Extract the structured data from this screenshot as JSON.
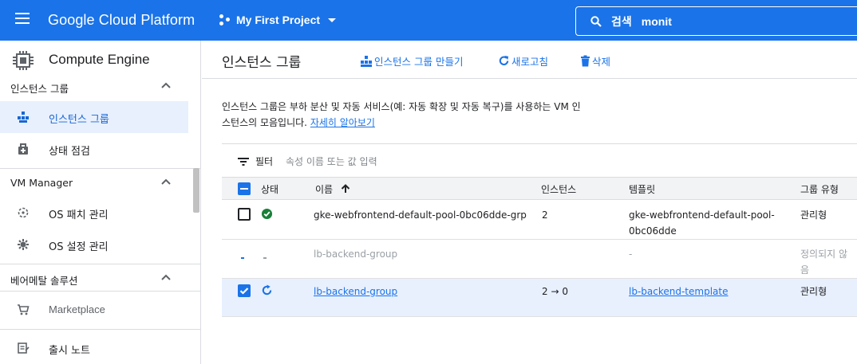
{
  "header": {
    "brand": "Google Cloud Platform",
    "project": "My First Project",
    "search_label": "검색",
    "search_value": "monit"
  },
  "sidebar": {
    "title": "Compute Engine",
    "sections": [
      {
        "label": "인스턴스 그룹",
        "items": [
          {
            "label": "인스턴스 그룹",
            "icon": "instance-groups-icon",
            "active": true
          },
          {
            "label": "상태 점검",
            "icon": "health-check-icon"
          }
        ]
      },
      {
        "label": "VM Manager",
        "items": [
          {
            "label": "OS 패치 관리",
            "icon": "os-patch-icon"
          },
          {
            "label": "OS 설정 관리",
            "icon": "os-config-icon"
          }
        ]
      },
      {
        "label": "베어메탈 솔루션",
        "items": []
      }
    ],
    "extra_items": [
      {
        "label": "Marketplace",
        "icon": "marketplace-cart-icon"
      },
      {
        "label": "출시 노트",
        "icon": "release-notes-icon"
      }
    ]
  },
  "toolbar": {
    "title": "인스턴스 그룹",
    "create_label": "인스턴스 그룹 만들기",
    "refresh_label": "새로고침",
    "delete_label": "삭제"
  },
  "description": {
    "line1": "인스턴스 그룹은 부하 분산 및 자동 서비스(예: 자동 확장 및 자동 복구)를 사용하는 VM 인",
    "line2": "스턴스의 모음입니다.",
    "link": "자세히 알아보기"
  },
  "filter": {
    "label": "필터",
    "placeholder": "속성 이름 또는 값 입력"
  },
  "table": {
    "columns": {
      "status": "상태",
      "name": "이름",
      "instances": "인스턴스",
      "template": "템플릿",
      "group_type": "그룹 유형"
    },
    "rows": [
      {
        "checked": false,
        "status": "ok",
        "name": "gke-webfrontend-default-pool-0bc06dde-grp",
        "instances": "2",
        "template_l1": "gke-webfrontend-default-pool-",
        "template_l2": "0bc06dde",
        "group_type": "관리형"
      },
      {
        "checked": false,
        "status": "loading",
        "name": "lb-backend-group",
        "instances": "",
        "template_l1": "-",
        "template_l2": "",
        "group_type_l1": "정의되지 않",
        "group_type_l2": "음"
      },
      {
        "checked": true,
        "status": "updating",
        "name": "lb-backend-group",
        "instances": "2 → 0",
        "template_l1": "lb-backend-template",
        "template_l2": "",
        "group_type": "관리형"
      }
    ]
  },
  "colors": {
    "brand_blue": "#1a73e8",
    "ok_green": "#188038",
    "selected_row": "#e8f0fe"
  }
}
